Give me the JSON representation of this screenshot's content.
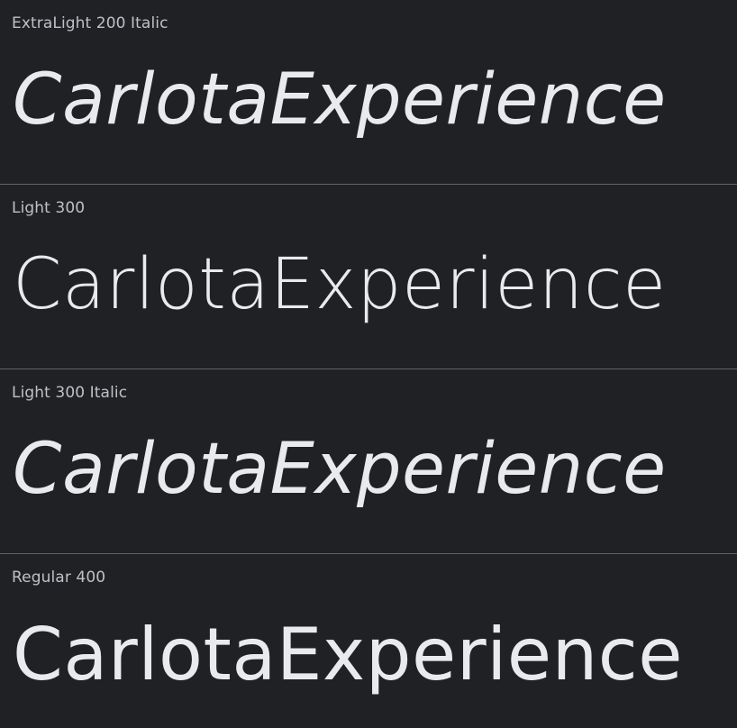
{
  "background_color": "#202124",
  "divider_color": "#5f6368",
  "label_color": "#bdc1c6",
  "sample_color": "#e8eaed",
  "specimens": [
    {
      "style_label": "ExtraLight 200 Italic",
      "sample_text": "CarlotaExperience"
    },
    {
      "style_label": "Light 300",
      "sample_text": "CarlotaExperience"
    },
    {
      "style_label": "Light 300 Italic",
      "sample_text": "CarlotaExperience"
    },
    {
      "style_label": "Regular 400",
      "sample_text": "CarlotaExperience"
    }
  ]
}
